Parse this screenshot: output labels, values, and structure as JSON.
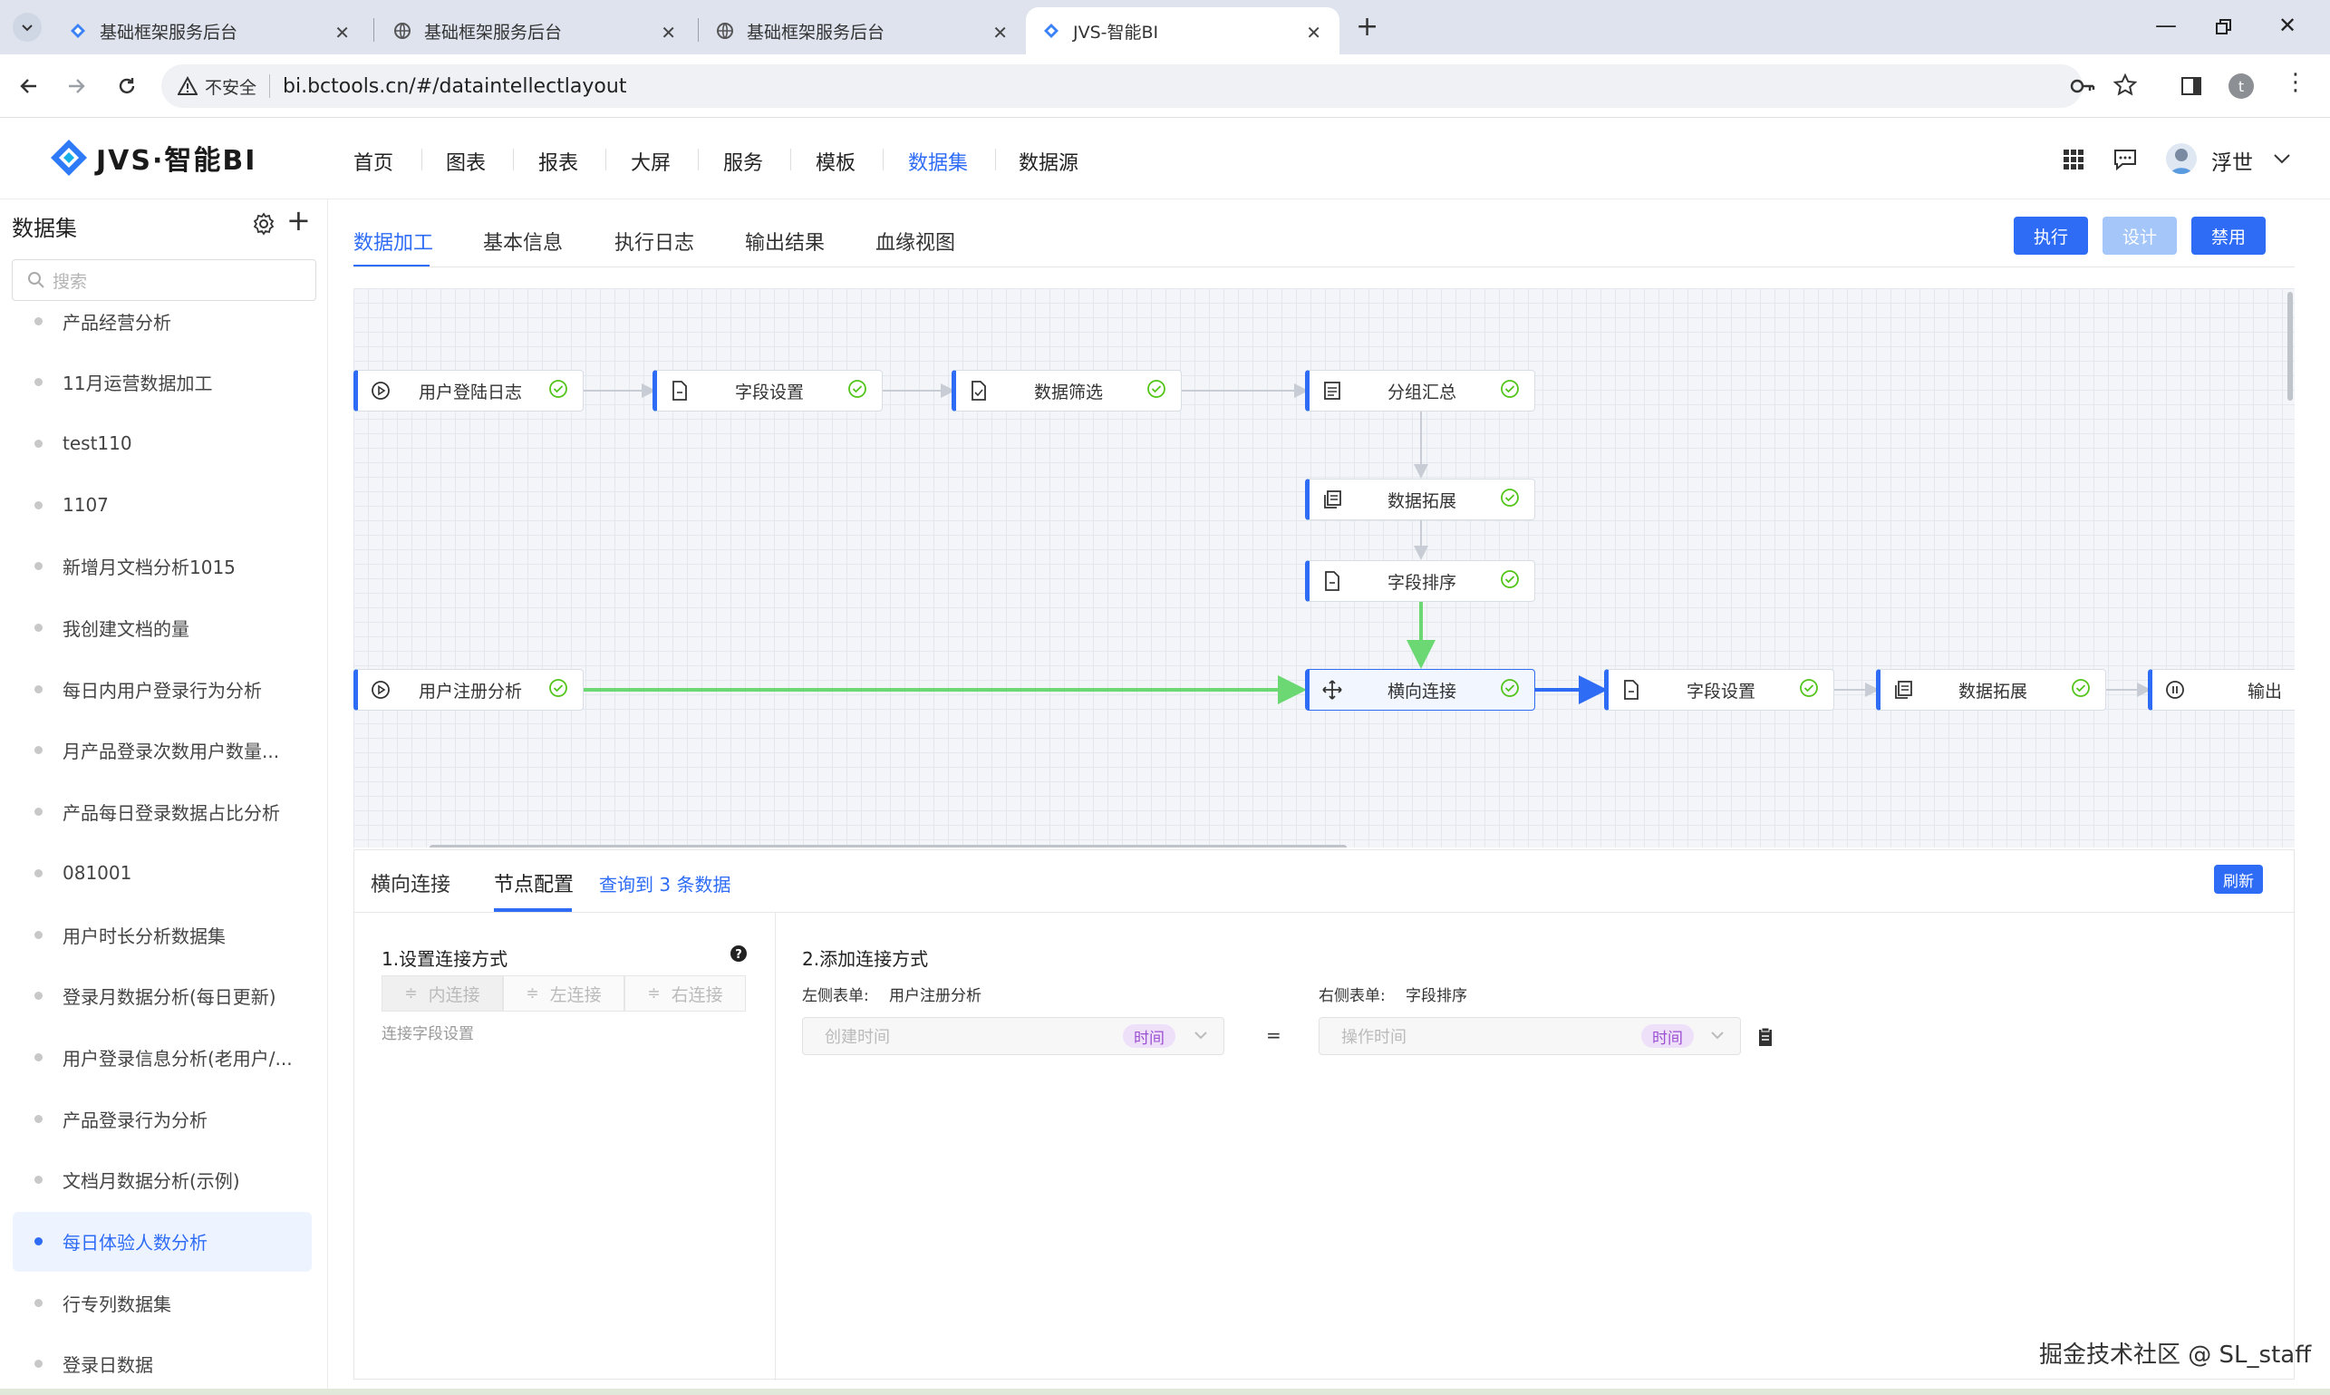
{
  "browser": {
    "tabs": [
      {
        "title": "基础框架服务后台"
      },
      {
        "title": "基础框架服务后台"
      },
      {
        "title": "基础框架服务后台"
      },
      {
        "title": "JVS-智能BI"
      }
    ],
    "new_tab": "+",
    "security_label": "不安全",
    "url": "bi.bctools.cn/#/dataintellectlayout",
    "profile_initial": "t"
  },
  "app": {
    "logo": "JVS·智能BI",
    "nav": [
      "首页",
      "图表",
      "报表",
      "大屏",
      "服务",
      "模板",
      "数据集",
      "数据源"
    ],
    "active_nav": "数据集",
    "user_name": "浮世"
  },
  "sidebar": {
    "title": "数据集",
    "search_placeholder": "搜索",
    "items": [
      "产品经营分析",
      "11月运营数据加工",
      "test110",
      "1107",
      "新增月文档分析1015",
      "我创建文档的量",
      "每日内用户登录行为分析",
      "月产品登录次数用户数量...",
      "产品每日登录数据占比分析",
      "081001",
      "用户时长分析数据集",
      "登录月数据分析(每日更新)",
      "用户登录信息分析(老用户/...",
      "产品登录行为分析",
      "文档月数据分析(示例)",
      "每日体验人数分析",
      "行专列数据集",
      "登录日数据"
    ],
    "active_item": "每日体验人数分析"
  },
  "main": {
    "tabs": [
      "数据加工",
      "基本信息",
      "执行日志",
      "输出结果",
      "血缘视图"
    ],
    "active_tab": "数据加工",
    "buttons": {
      "run": "执行",
      "design": "设计",
      "disable": "禁用"
    }
  },
  "flow": {
    "nodes": [
      {
        "id": "n1",
        "label": "用户登陆日志",
        "icon": "play-circle-icon",
        "status": "success"
      },
      {
        "id": "n2",
        "label": "字段设置",
        "icon": "document-icon",
        "status": "success"
      },
      {
        "id": "n3",
        "label": "数据筛选",
        "icon": "filter-doc-icon",
        "status": "success"
      },
      {
        "id": "n4",
        "label": "分组汇总",
        "icon": "list-doc-icon",
        "status": "success"
      },
      {
        "id": "n5",
        "label": "数据拓展",
        "icon": "copy-doc-icon",
        "status": "success"
      },
      {
        "id": "n6",
        "label": "字段排序",
        "icon": "document-icon",
        "status": "success"
      },
      {
        "id": "n7",
        "label": "用户注册分析",
        "icon": "play-circle-icon",
        "status": "success"
      },
      {
        "id": "n8",
        "label": "横向连接",
        "icon": "move-icon",
        "status": "success"
      },
      {
        "id": "n9",
        "label": "字段设置",
        "icon": "document-icon",
        "status": "success"
      },
      {
        "id": "n10",
        "label": "数据拓展",
        "icon": "copy-doc-icon",
        "status": "success"
      },
      {
        "id": "n11",
        "label": "输出",
        "icon": "pause-circle-icon",
        "status": ""
      }
    ],
    "selected": "横向连接"
  },
  "panel": {
    "tabs": [
      "横向连接",
      "节点配置"
    ],
    "active_tab": "节点配置",
    "query_result": "查询到 3 条数据",
    "refresh": "刷新",
    "section1_title": "1.设置连接方式",
    "join_types": [
      "内连接",
      "左连接",
      "右连接"
    ],
    "join_field_label": "连接字段设置",
    "section2_title": "2.添加连接方式",
    "left_table_label": "左侧表单:",
    "left_table": "用户注册分析",
    "right_table_label": "右侧表单:",
    "right_table": "字段排序",
    "left_field": "创建时间",
    "right_field": "操作时间",
    "type_tag": "时间",
    "equals": "="
  },
  "watermark": "掘金技术社区 @ SL_staff",
  "colors": {
    "primary": "#2f6cf6",
    "success": "#52c41a",
    "flow_green": "#6bd873",
    "design_disabled": "#a4c6f9"
  }
}
